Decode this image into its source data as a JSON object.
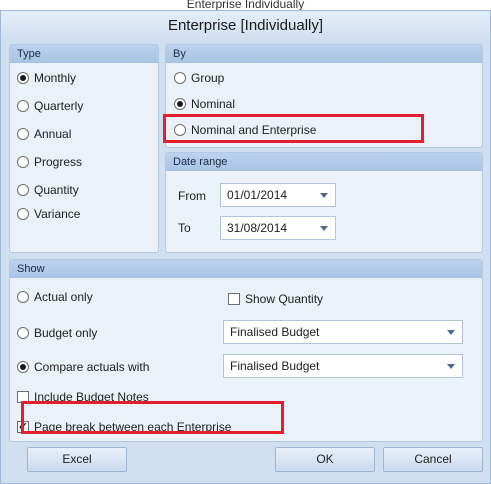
{
  "header_fragment": "Enterprise Individually",
  "dialog": {
    "title": "Enterprise [Individually]"
  },
  "type_group": {
    "header": "Type",
    "options": [
      "Monthly",
      "Quarterly",
      "Annual",
      "Progress",
      "Quantity",
      "Variance"
    ],
    "selected": "Monthly"
  },
  "by_group": {
    "header": "By",
    "options": [
      "Group",
      "Nominal",
      "Nominal and Enterprise"
    ],
    "selected": "Nominal"
  },
  "date_range": {
    "header": "Date range",
    "from_label": "From",
    "from_value": "01/01/2014",
    "to_label": "To",
    "to_value": "31/08/2014"
  },
  "show_group": {
    "header": "Show",
    "actual_only": "Actual only",
    "budget_only": "Budget only",
    "compare_with": "Compare actuals with",
    "selected": "Compare actuals with",
    "show_quantity": "Show Quantity",
    "show_quantity_checked": false,
    "budget_dropdown": "Finalised Budget",
    "compare_dropdown": "Finalised Budget",
    "include_budget_notes": "Include Budget Notes",
    "include_budget_notes_checked": false,
    "page_break": "Page break between each Enterprise",
    "page_break_checked": true
  },
  "buttons": {
    "excel": "Excel",
    "ok": "OK",
    "cancel": "Cancel"
  },
  "colors": {
    "highlight": "#e31e2d",
    "accent": "#a8c3e4",
    "panel": "#eaf1f9"
  }
}
